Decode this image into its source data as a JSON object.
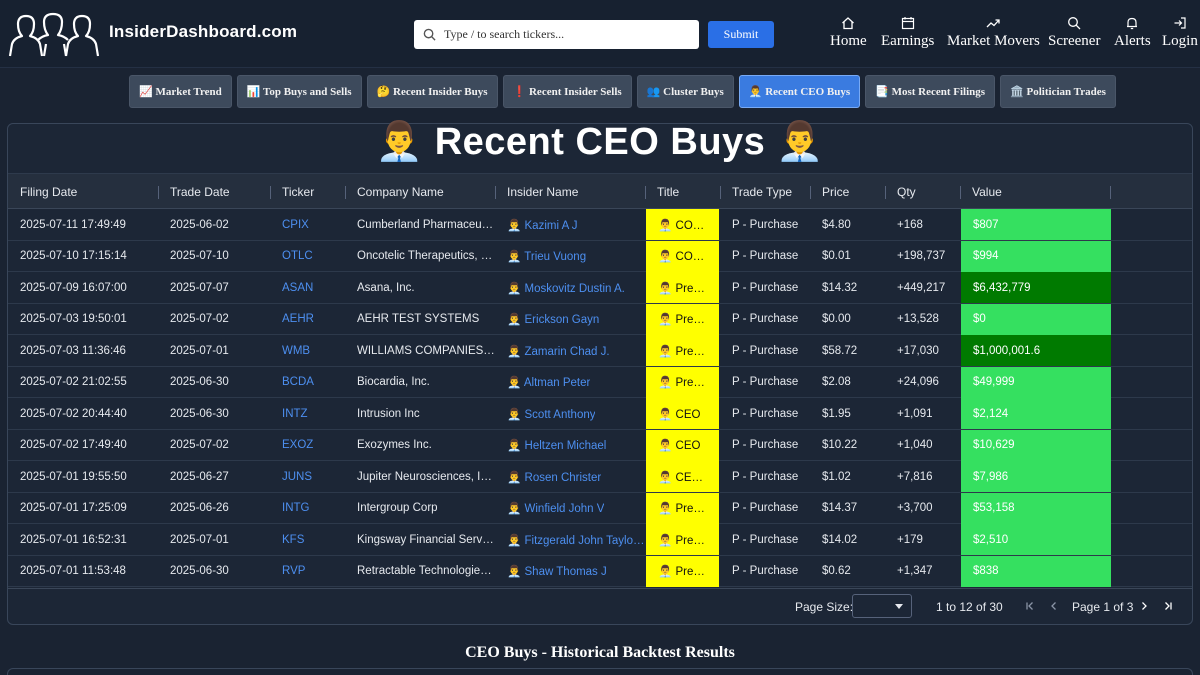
{
  "header": {
    "logo_text": "InsiderDashboard.com",
    "search_placeholder": "Type / to search tickers...",
    "submit_label": "Submit",
    "nav": [
      {
        "label": "Home",
        "icon": "home-icon"
      },
      {
        "label": "Earnings",
        "icon": "calendar-icon"
      },
      {
        "label": "Market Movers",
        "icon": "trending-icon"
      },
      {
        "label": "Screener",
        "icon": "search-icon"
      },
      {
        "label": "Alerts",
        "icon": "bell-icon"
      },
      {
        "label": "Login",
        "icon": "login-icon"
      }
    ]
  },
  "tabs": [
    {
      "label": "📈 Market Trend"
    },
    {
      "label": "📊 Top Buys and Sells"
    },
    {
      "label": "🤔 Recent Insider Buys"
    },
    {
      "label": "❗ Recent Insider Sells"
    },
    {
      "label": "👥 Cluster Buys"
    },
    {
      "label": "👨‍💼 Recent CEO Buys",
      "active": true
    },
    {
      "label": "📑 Most Recent Filings"
    },
    {
      "label": "🏛️ Politician Trades"
    }
  ],
  "page_title": "👨‍💼 Recent CEO Buys 👨‍💼",
  "columns": [
    "Filing Date",
    "Trade Date",
    "Ticker",
    "Company Name",
    "Insider Name",
    "Title",
    "Trade Type",
    "Price",
    "Qty",
    "Value"
  ],
  "rows": [
    {
      "filing": "2025-07-11 17:49:49",
      "trade": "2025-06-02",
      "ticker": "CPIX",
      "company": "Cumberland Pharmaceu…",
      "insider": "👨‍💼 Kazimi A J",
      "title": "👨‍💼 CO…",
      "type": "P - Purchase",
      "price": "$4.80",
      "qty": "+168",
      "value": "$807",
      "dark": false
    },
    {
      "filing": "2025-07-10 17:15:14",
      "trade": "2025-07-10",
      "ticker": "OTLC",
      "company": "Oncotelic Therapeutics, …",
      "insider": "👨‍💼 Trieu Vuong",
      "title": "👨‍💼 CO…",
      "type": "P - Purchase",
      "price": "$0.01",
      "qty": "+198,737",
      "value": "$994",
      "dark": false
    },
    {
      "filing": "2025-07-09 16:07:00",
      "trade": "2025-07-07",
      "ticker": "ASAN",
      "company": "Asana, Inc.",
      "insider": "👨‍💼 Moskovitz Dustin A.",
      "title": "👨‍💼 Pre…",
      "type": "P - Purchase",
      "price": "$14.32",
      "qty": "+449,217",
      "value": "$6,432,779",
      "dark": true
    },
    {
      "filing": "2025-07-03 19:50:01",
      "trade": "2025-07-02",
      "ticker": "AEHR",
      "company": "AEHR TEST SYSTEMS",
      "insider": "👨‍💼 Erickson Gayn",
      "title": "👨‍💼 Pre…",
      "type": "P - Purchase",
      "price": "$0.00",
      "qty": "+13,528",
      "value": "$0",
      "dark": false
    },
    {
      "filing": "2025-07-03 11:36:46",
      "trade": "2025-07-01",
      "ticker": "WMB",
      "company": "WILLIAMS COMPANIES…",
      "insider": "👨‍💼 Zamarin Chad J.",
      "title": "👨‍💼 Pre…",
      "type": "P - Purchase",
      "price": "$58.72",
      "qty": "+17,030",
      "value": "$1,000,001.6",
      "dark": true
    },
    {
      "filing": "2025-07-02 21:02:55",
      "trade": "2025-06-30",
      "ticker": "BCDA",
      "company": "Biocardia, Inc.",
      "insider": "👨‍💼 Altman Peter",
      "title": "👨‍💼 Pre…",
      "type": "P - Purchase",
      "price": "$2.08",
      "qty": "+24,096",
      "value": "$49,999",
      "dark": false
    },
    {
      "filing": "2025-07-02 20:44:40",
      "trade": "2025-06-30",
      "ticker": "INTZ",
      "company": "Intrusion Inc",
      "insider": "👨‍💼 Scott Anthony",
      "title": "👨‍💼 CEO",
      "type": "P - Purchase",
      "price": "$1.95",
      "qty": "+1,091",
      "value": "$2,124",
      "dark": false
    },
    {
      "filing": "2025-07-02 17:49:40",
      "trade": "2025-07-02",
      "ticker": "EXOZ",
      "company": "Exozymes Inc.",
      "insider": "👨‍💼 Heltzen Michael",
      "title": "👨‍💼 CEO",
      "type": "P - Purchase",
      "price": "$10.22",
      "qty": "+1,040",
      "value": "$10,629",
      "dark": false
    },
    {
      "filing": "2025-07-01 19:55:50",
      "trade": "2025-06-27",
      "ticker": "JUNS",
      "company": "Jupiter Neurosciences, I…",
      "insider": "👨‍💼 Rosen Christer",
      "title": "👨‍💼 CE…",
      "type": "P - Purchase",
      "price": "$1.02",
      "qty": "+7,816",
      "value": "$7,986",
      "dark": false
    },
    {
      "filing": "2025-07-01 17:25:09",
      "trade": "2025-06-26",
      "ticker": "INTG",
      "company": "Intergroup Corp",
      "insider": "👨‍💼 Winfield John V",
      "title": "👨‍💼 Pre…",
      "type": "P - Purchase",
      "price": "$14.37",
      "qty": "+3,700",
      "value": "$53,158",
      "dark": false
    },
    {
      "filing": "2025-07-01 16:52:31",
      "trade": "2025-07-01",
      "ticker": "KFS",
      "company": "Kingsway Financial Serv…",
      "insider": "👨‍💼 Fitzgerald John Taylo…",
      "title": "👨‍💼 Pre…",
      "type": "P - Purchase",
      "price": "$14.02",
      "qty": "+179",
      "value": "$2,510",
      "dark": false
    },
    {
      "filing": "2025-07-01 11:53:48",
      "trade": "2025-06-30",
      "ticker": "RVP",
      "company": "Retractable Technologie…",
      "insider": "👨‍💼 Shaw Thomas J",
      "title": "👨‍💼 Pre…",
      "type": "P - Purchase",
      "price": "$0.62",
      "qty": "+1,347",
      "value": "$838",
      "dark": false
    }
  ],
  "pagination": {
    "page_size_label": "Page Size:",
    "page_size_value": "",
    "rows_info": "1 to 12 of 30",
    "page_info": "Page 1 of 3"
  },
  "backtest_title": "CEO Buys - Historical Backtest Results",
  "colors": {
    "accent": "#2a6fe6",
    "title_bg": "#ffff00",
    "value_light": "#35e060",
    "value_dark": "#007a00",
    "link": "#4d8ff0"
  }
}
